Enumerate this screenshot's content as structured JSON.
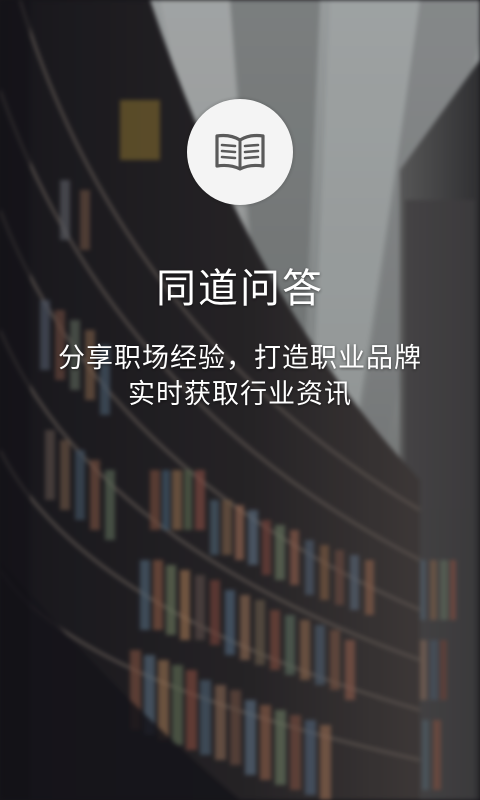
{
  "app": {
    "name": "同道问答",
    "logo_icon": "open-book-icon"
  },
  "slogan": {
    "line1": "分享职场经验，打造职业品牌",
    "line2": "实时获取行业资讯"
  },
  "colors": {
    "text": "#ffffff",
    "logo_bg": "#f4f4f4",
    "logo_icon": "#5a5a5a"
  }
}
